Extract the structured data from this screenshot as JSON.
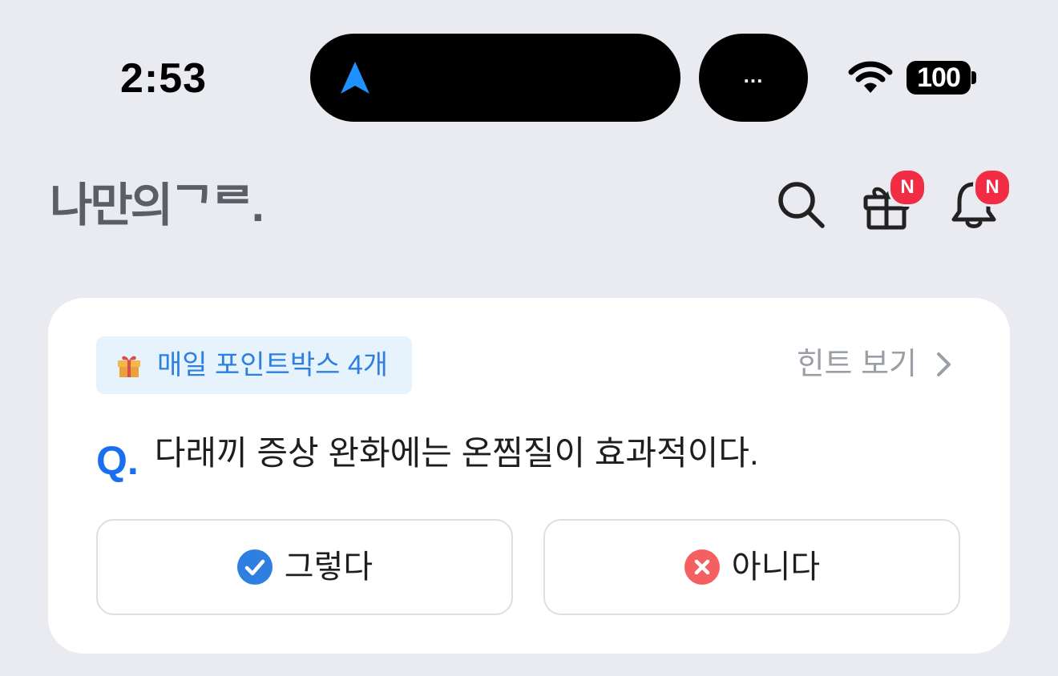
{
  "status": {
    "time": "2:53",
    "more_label": "...",
    "battery": "100"
  },
  "header": {
    "logo": "나만의ᄀᄅ.",
    "gift_badge": "N",
    "bell_badge": "N"
  },
  "card": {
    "chip_label": "매일 포인트박스 4개",
    "hint_label": "힌트 보기",
    "question_prefix": "Q.",
    "question_text": "다래끼 증상 완화에는 온찜질이 효과적이다.",
    "answer_yes": "그렇다",
    "answer_no": "아니다"
  },
  "colors": {
    "background": "#e9ebf0",
    "accent": "#1a6ff0",
    "badge": "#f22c45",
    "yes": "#2f7fe0",
    "no": "#f46060"
  }
}
